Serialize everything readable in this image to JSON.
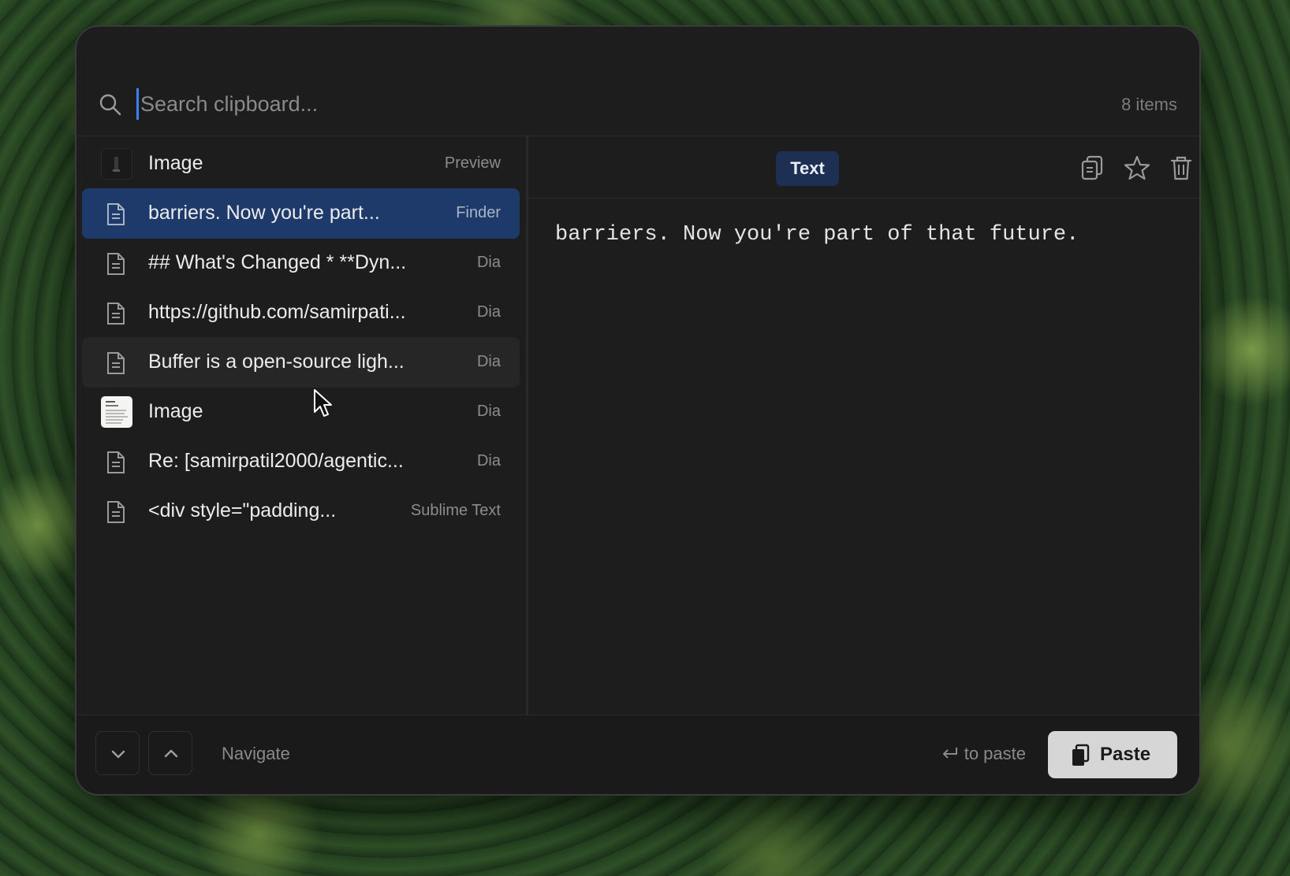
{
  "search": {
    "placeholder": "Search clipboard...",
    "value": ""
  },
  "items_count": "8 items",
  "list": {
    "items": [
      {
        "label": "Image",
        "source": "Preview",
        "kind": "image-dark",
        "state": "normal"
      },
      {
        "label": "barriers. Now you're part...",
        "source": "Finder",
        "kind": "text",
        "state": "selected"
      },
      {
        "label": "## What's Changed * **Dyn...",
        "source": "Dia",
        "kind": "text",
        "state": "normal"
      },
      {
        "label": "https://github.com/samirpati...",
        "source": "Dia",
        "kind": "text",
        "state": "normal"
      },
      {
        "label": "Buffer is a open-source ligh...",
        "source": "Dia",
        "kind": "text",
        "state": "hover"
      },
      {
        "label": "Image",
        "source": "Dia",
        "kind": "image-doc",
        "state": "normal"
      },
      {
        "label": "Re: [samirpatil2000/agentic...",
        "source": "Dia",
        "kind": "text",
        "state": "normal"
      },
      {
        "label": "<div style=\"padding...",
        "source": "Sublime Text",
        "kind": "text",
        "state": "normal"
      }
    ]
  },
  "preview": {
    "type_badge": "Text",
    "content": "barriers. Now you're part of that future.",
    "actions": [
      "copy-icon",
      "star-icon",
      "trash-icon"
    ]
  },
  "footer": {
    "navigate_label": "Navigate",
    "paste_hint": "to paste",
    "paste_button": "Paste"
  },
  "colors": {
    "selected_row": "#1e3a6b",
    "badge_bg": "#1d2f52",
    "window_bg": "#1d1d1d",
    "caret": "#3b82f6"
  }
}
